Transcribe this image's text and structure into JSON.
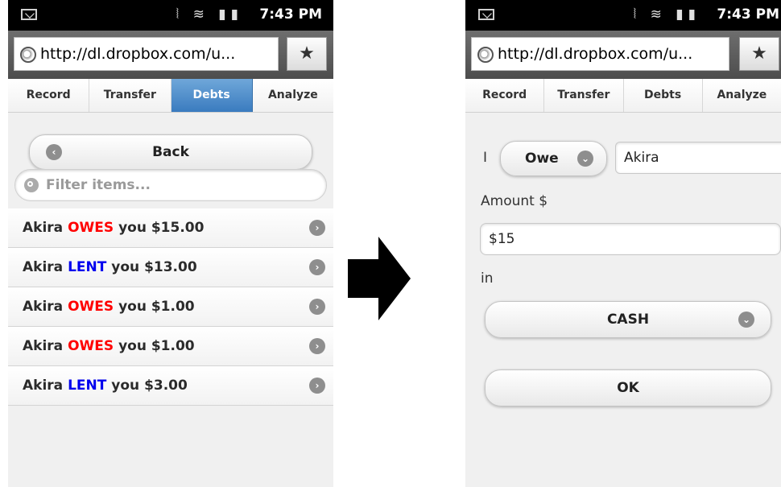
{
  "status_bar": {
    "time": "7:43 PM"
  },
  "browser": {
    "url": "http://dl.dropbox.com/u..."
  },
  "nav_tabs": [
    "Record",
    "Transfer",
    "Debts",
    "Analyze"
  ],
  "left_screen": {
    "active_tab": "Debts",
    "back_label": "Back",
    "filter_placeholder": "Filter items...",
    "debts": [
      {
        "name": "Akira",
        "verb": "OWES",
        "rest": "you $15.00",
        "verb_color": "#ff0000"
      },
      {
        "name": "Akira",
        "verb": "LENT",
        "rest": "you $13.00",
        "verb_color": "#0000ee"
      },
      {
        "name": "Akira",
        "verb": "OWES",
        "rest": "you $1.00",
        "verb_color": "#ff0000"
      },
      {
        "name": "Akira",
        "verb": "OWES",
        "rest": "you $1.00",
        "verb_color": "#ff0000"
      },
      {
        "name": "Akira",
        "verb": "LENT",
        "rest": "you $3.00",
        "verb_color": "#0000ee"
      }
    ]
  },
  "right_screen": {
    "prefix": "I",
    "relation_value": "Owe",
    "person": "Akira",
    "amount_label": "Amount $",
    "amount_value": "$15",
    "in_label": "in",
    "account_value": "CASH",
    "ok_label": "OK"
  },
  "colors": {
    "active_tab": "#3a7bbf",
    "owes": "#ff0000",
    "lent": "#0000ee"
  }
}
